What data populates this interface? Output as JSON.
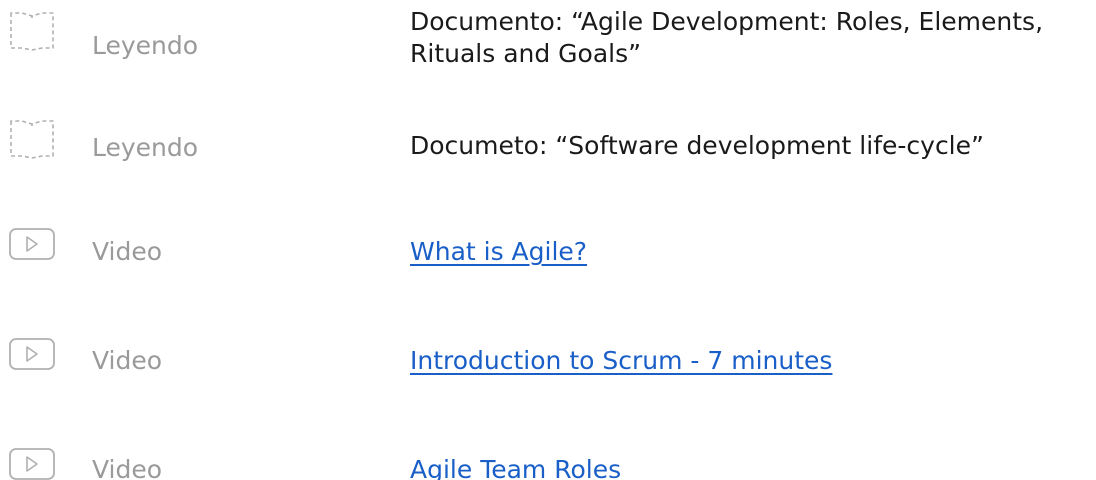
{
  "colors": {
    "type_label": "#9a9a9a",
    "title_text": "#1a1a1a",
    "link": "#1a5fc8",
    "icon_stroke": "#b0b0b0"
  },
  "items": [
    {
      "type": "Leyendo",
      "icon": "reading-icon",
      "title_line1": "Documento: “Agile Development: Roles, Elements,",
      "title_line2": "Rituals and Goals”",
      "is_link": false
    },
    {
      "type": "Leyendo",
      "icon": "reading-icon",
      "title": "Documeto: “Software development life-cycle”",
      "is_link": false
    },
    {
      "type": "Video",
      "icon": "video-play-icon",
      "title": "What is Agile?",
      "is_link": true
    },
    {
      "type": "Video",
      "icon": "video-play-icon",
      "title": "Introduction to Scrum - 7 minutes",
      "is_link": true
    },
    {
      "type": "Video",
      "icon": "video-play-icon",
      "title": "Agile Team Roles",
      "is_link": true
    }
  ]
}
